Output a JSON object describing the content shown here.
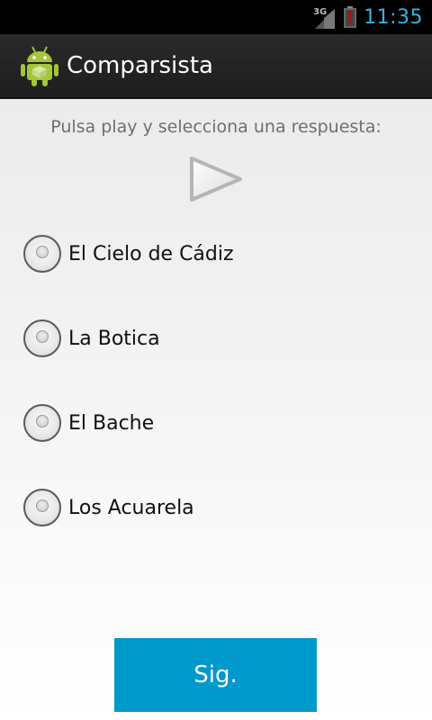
{
  "status_bar": {
    "network_type": "3G",
    "time": "11:35",
    "colors": {
      "clock": "#33b5e5",
      "battery_alert": "#cc0000"
    }
  },
  "action_bar": {
    "title": "Comparsista",
    "icon": "android-robot-icon"
  },
  "quiz": {
    "prompt": "Pulsa play y selecciona una respuesta:",
    "play_icon": "play-icon",
    "options": [
      {
        "label": "El Cielo de Cádiz",
        "selected": false
      },
      {
        "label": "La Botica",
        "selected": false
      },
      {
        "label": "El Bache",
        "selected": false
      },
      {
        "label": "Los Acuarela",
        "selected": false
      }
    ],
    "next_label": "Sig."
  },
  "colors": {
    "accent": "#0099cc",
    "action_bar": "#222222",
    "background": "#f0f0f0"
  }
}
